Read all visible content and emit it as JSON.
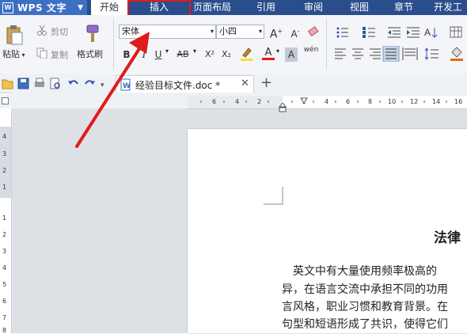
{
  "app": {
    "logo": "W",
    "name": "WPS 文字",
    "menu_arrow": "▼"
  },
  "tabs": [
    "开始",
    "插入",
    "页面布局",
    "引用",
    "审阅",
    "视图",
    "章节",
    "开发工"
  ],
  "clipboard": {
    "cut": "剪切",
    "copy": "复制",
    "paste": "粘贴",
    "format_painter": "格式刷"
  },
  "font": {
    "name": "宋体",
    "size": "小四"
  },
  "format_buttons": {
    "bold": "B",
    "italic": "I",
    "underline": "U",
    "strike": "AB",
    "superscript": "X²",
    "subscript": "X₂",
    "font_color": "A",
    "char_shade": "A",
    "phonetic": "wén"
  },
  "document": {
    "tab_name": "经验目标文件.doc *",
    "heading": "法律",
    "lines": [
      "英文中有大量使用频率极高的",
      "异，在语言交流中承担不同的功用",
      "言风格，职业习惯和教育背景。在",
      "句型和短语形成了共识，使得它们"
    ]
  },
  "ruler": {
    "h_numbers": [
      "6",
      "4",
      "2",
      "2",
      "4",
      "6",
      "8",
      "10",
      "12",
      "14",
      "16"
    ],
    "v_numbers": [
      "4",
      "3",
      "2",
      "1",
      "1",
      "2",
      "3",
      "4",
      "5",
      "6",
      "7",
      "8"
    ]
  },
  "colors": {
    "menubar": "#2a4d8c",
    "app_button": "#3d6fc3",
    "annotation": "#e01b1b",
    "canvas": "#dde1e6"
  }
}
